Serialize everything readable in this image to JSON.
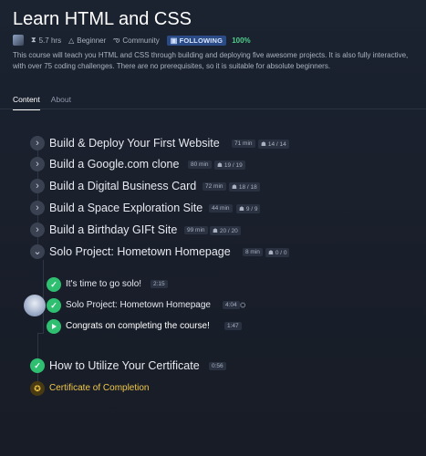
{
  "course": {
    "title": "Learn HTML and CSS",
    "hours": "5.7 hrs",
    "level": "Beginner",
    "category": "Community",
    "follow_label": "FOLLOWING",
    "progress": "100%",
    "description": "This course will teach you HTML and CSS through building and deploying five awesome projects. It is also fully interactive, with over 75 coding challenges. There are no prerequisites, so it is suitable for absolute beginners."
  },
  "tabs": [
    {
      "label": "Content",
      "active": true
    },
    {
      "label": "About",
      "active": false
    }
  ],
  "sections": [
    {
      "title": "Build & Deploy Your First Website",
      "duration": "71 min",
      "progress": "14 / 14"
    },
    {
      "title": "Build a Google.com clone",
      "duration": "80 min",
      "progress": "19 / 19"
    },
    {
      "title": "Build a Digital Business Card",
      "duration": "72 min",
      "progress": "18 / 18"
    },
    {
      "title": "Build a Space Exploration Site",
      "duration": "44 min",
      "progress": "9 / 9"
    },
    {
      "title": "Build a Birthday GIFt Site",
      "duration": "99 min",
      "progress": "20 / 20"
    },
    {
      "title": "Solo Project: Hometown Homepage",
      "duration": "8 min",
      "progress": "0 / 0"
    }
  ],
  "lessons": [
    {
      "title": "It's time to go solo!",
      "duration": "2:15"
    },
    {
      "title": "Solo Project: Hometown Homepage",
      "duration": "4:04"
    },
    {
      "title": "Congrats on completing the course!",
      "duration": "1:47"
    }
  ],
  "final": {
    "title": "How to Utilize Your Certificate",
    "duration": "0:56"
  },
  "certificate": {
    "title": "Certificate of Completion"
  },
  "icons": {
    "chevron": "chevron-right-icon",
    "check": "check-icon",
    "play": "play-icon",
    "certificate": "certificate-icon"
  },
  "colors": {
    "accent_green": "#2fbf71",
    "follow_bg": "#2b4b86",
    "certificate_gold": "#f2c84b"
  }
}
